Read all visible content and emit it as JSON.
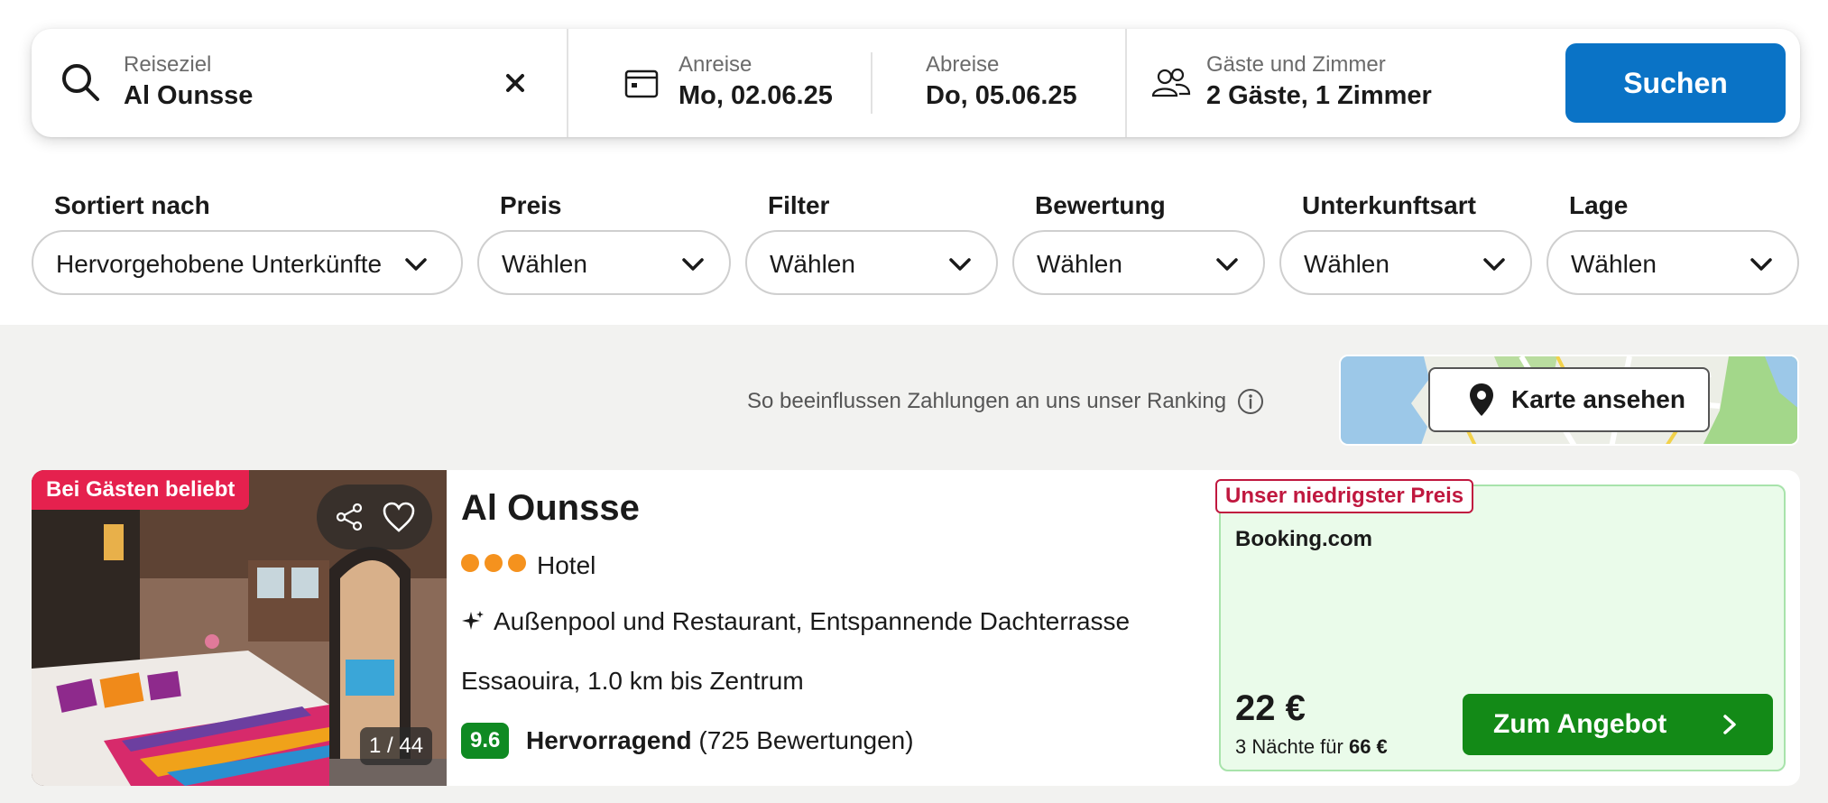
{
  "search": {
    "destination_label": "Reiseziel",
    "destination_value": "Al Ounsse",
    "checkin_label": "Anreise",
    "checkin_value": "Mo, 02.06.25",
    "checkout_label": "Abreise",
    "checkout_value": "Do, 05.06.25",
    "guests_label": "Gäste und Zimmer",
    "guests_value": "2 Gäste, 1 Zimmer",
    "search_button": "Suchen",
    "button_color": "#0a73c6"
  },
  "filters": [
    {
      "label": "Sortiert nach",
      "value": "Hervorgehobene Unterkünfte"
    },
    {
      "label": "Preis",
      "value": "Wählen"
    },
    {
      "label": "Filter",
      "value": "Wählen"
    },
    {
      "label": "Bewertung",
      "value": "Wählen"
    },
    {
      "label": "Unterkunftsart",
      "value": "Wählen"
    },
    {
      "label": "Lage",
      "value": "Wählen"
    }
  ],
  "ranking_note": "So beeinflussen Zahlungen an uns unser Ranking",
  "map_button": "Karte ansehen",
  "hotel": {
    "popular_badge": "Bei Gästen beliebt",
    "photo_counter": "1 / 44",
    "name": "Al Ounsse",
    "star_count": 3,
    "type": "Hotel",
    "amenities": "Außenpool und Restaurant, Entspannende Dachterrasse",
    "location": "Essaouira, 1.0 km bis Zentrum",
    "rating_score": "9.6",
    "rating_word": "Hervorragend",
    "rating_count": "(725 Bewertungen)",
    "rating_color": "#0f8a22"
  },
  "deal": {
    "lowest_badge": "Unser niedrigster Preis",
    "provider": "Booking.com",
    "price": "22 €",
    "nights_prefix": "3 Nächte für",
    "nights_total": "66 €",
    "offer_button": "Zum Angebot",
    "offer_color": "#138a17",
    "lowest_color": "#c0183f",
    "popular_color": "#e5214e"
  }
}
